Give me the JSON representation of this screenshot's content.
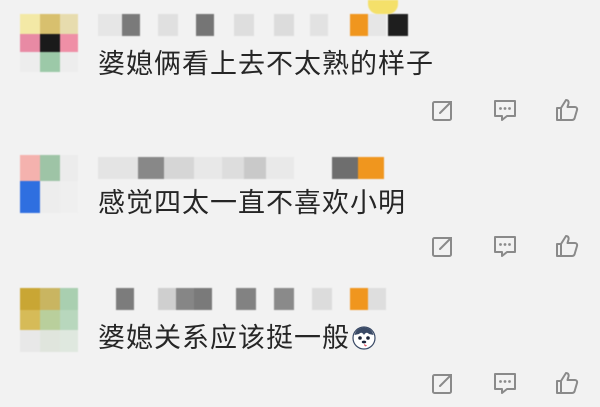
{
  "comments": [
    {
      "text": "婆媳俩看上去不太熟的样子",
      "username": "",
      "actions": [
        "share-icon",
        "reply-icon",
        "like-icon"
      ]
    },
    {
      "text": "感觉四太一直不喜欢小明",
      "username": "",
      "actions": [
        "share-icon",
        "reply-icon",
        "like-icon"
      ]
    },
    {
      "text": "婆媳关系应该挺一般",
      "username": "",
      "emoji": "husky-face-emoji",
      "actions": [
        "share-icon",
        "reply-icon",
        "like-icon"
      ]
    }
  ],
  "colors": {
    "background": "#f2f2f2",
    "text": "#262626",
    "icon": "#8a8a8a",
    "accent_orange": "#f0961e",
    "accent_blue": "#2f6fe0"
  }
}
